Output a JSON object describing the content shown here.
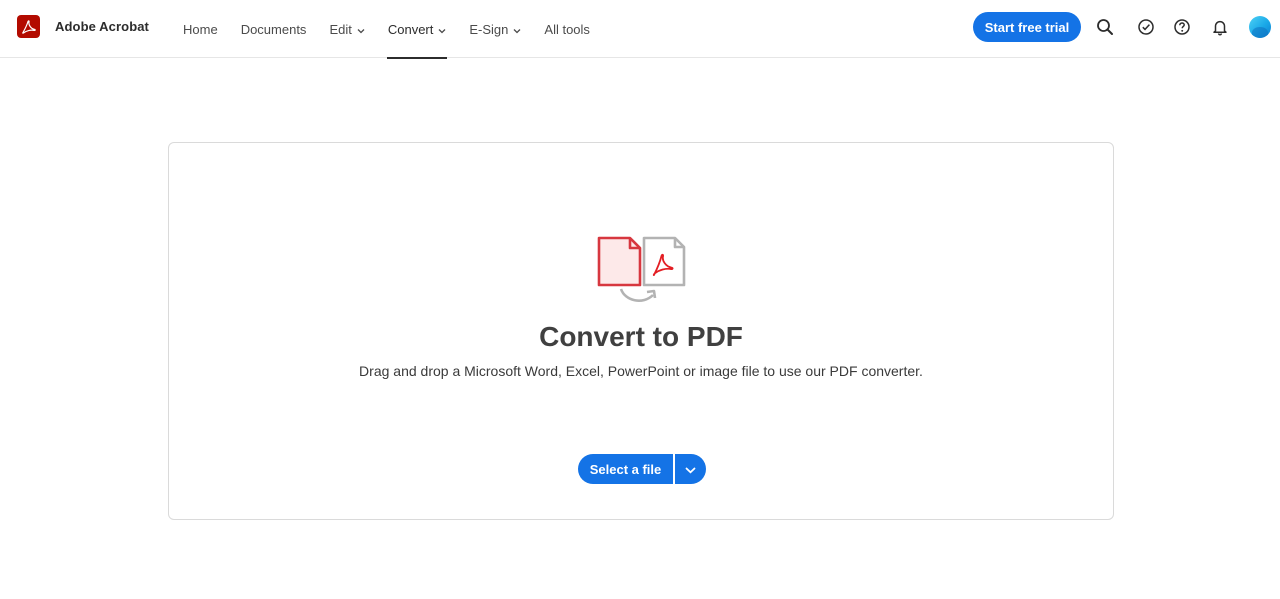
{
  "app": {
    "name": "Adobe Acrobat"
  },
  "nav": [
    {
      "label": "Home",
      "dropdown": false
    },
    {
      "label": "Documents",
      "dropdown": false
    },
    {
      "label": "Edit",
      "dropdown": true
    },
    {
      "label": "Convert",
      "dropdown": true,
      "active": true
    },
    {
      "label": "E-Sign",
      "dropdown": true
    },
    {
      "label": "All tools",
      "dropdown": false
    }
  ],
  "header": {
    "trial_label": "Start free trial",
    "icons": [
      "search-icon",
      "task-check-icon",
      "help-icon",
      "bell-icon",
      "avatar"
    ]
  },
  "main": {
    "title": "Convert to PDF",
    "subtitle": "Drag and drop a Microsoft Word, Excel, PowerPoint or image file to use our PDF converter.",
    "select_label": "Select a file"
  },
  "colors": {
    "brand_red": "#b30b00",
    "accent_blue": "#1473e6",
    "text_dark": "#2c2c2c"
  }
}
